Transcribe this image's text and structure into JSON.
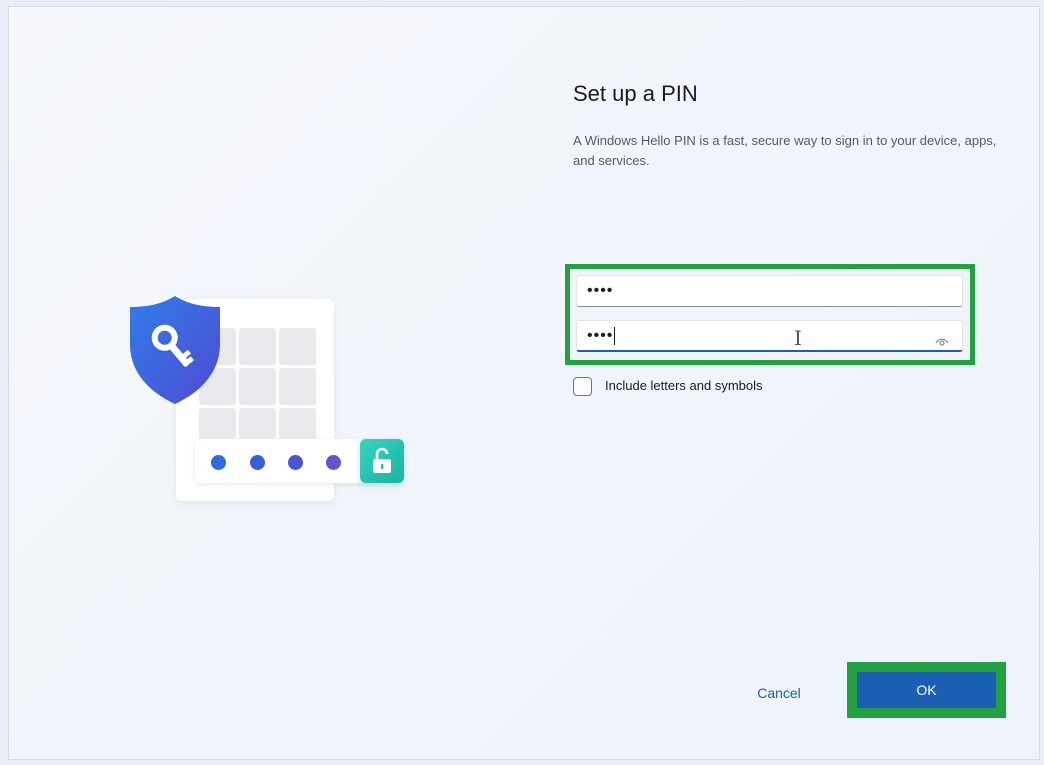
{
  "page": {
    "title": "Set up a PIN",
    "description": "A Windows Hello PIN is a fast, secure way to sign in to your device, apps, and services."
  },
  "pin_form": {
    "new_pin_value": "••••",
    "confirm_pin_value": "••••",
    "include_letters_label": "Include letters and symbols",
    "include_letters_checked": false
  },
  "actions": {
    "cancel_label": "Cancel",
    "ok_label": "OK"
  },
  "icons": {
    "shield": "shield-key-icon",
    "unlock": "unlock-icon",
    "reveal": "eye-icon"
  },
  "colors": {
    "accent": "#1a5fb4",
    "highlight": "#22a042",
    "pin_dots": [
      "#2d6be0",
      "#3560da",
      "#4a55d6",
      "#6a4fd1"
    ]
  }
}
